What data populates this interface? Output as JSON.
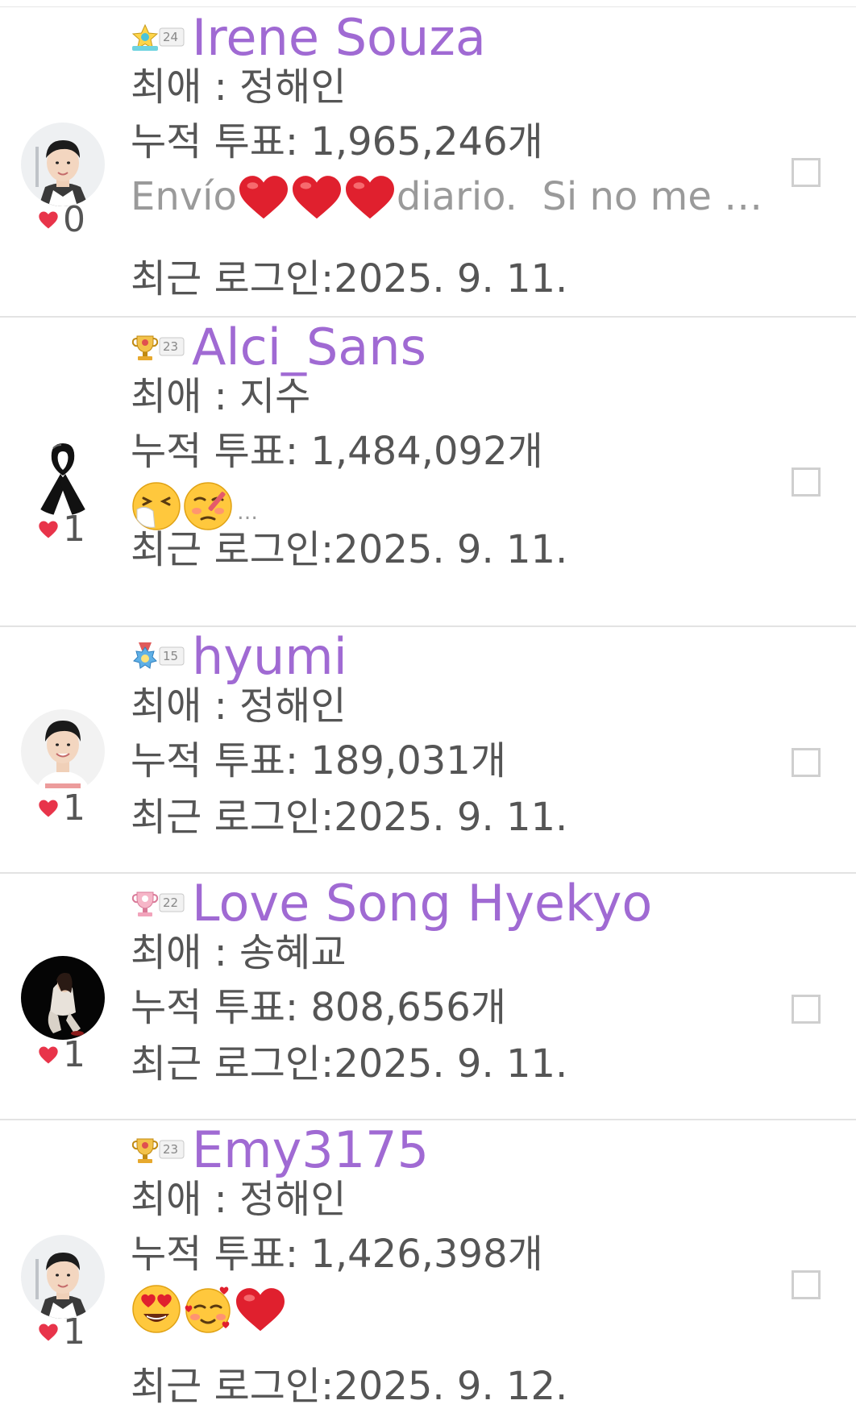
{
  "labels": {
    "favorite_prefix": "최애 : ",
    "votes_prefix": "누적 투표: ",
    "votes_suffix": "개",
    "login_prefix": "최근 로그인:"
  },
  "colors": {
    "username": "#a06ad3",
    "text": "#555555",
    "muted": "#9a9a9a",
    "heart": "#e8344a",
    "divider": "#e3e3e3"
  },
  "users": [
    {
      "badge_icon": "star-badge-icon",
      "badge_level": "24",
      "username": "Irene Souza",
      "favorite": "정해인",
      "votes": "1,965,246",
      "status_parts": [
        "Envío",
        "❤️",
        "❤️",
        "❤️",
        "diario.  Si no me …"
      ],
      "last_login": "2025. 9. 11.",
      "likes": "0",
      "avatar": "man-photo-avatar"
    },
    {
      "badge_icon": "trophy-badge-icon",
      "badge_level": "23",
      "username": "Alci_Sans",
      "favorite": "지수",
      "votes": "1,484,092",
      "status_parts": [
        "🤧",
        "🤒",
        "…"
      ],
      "last_login": "2025. 9. 11.",
      "likes": "1",
      "avatar": "black-ribbon-avatar"
    },
    {
      "badge_icon": "medal-badge-icon",
      "badge_level": "15",
      "username": "hyumi",
      "favorite": "정해인",
      "votes": "189,031",
      "status_parts": [],
      "last_login": "2025. 9. 11.",
      "likes": "1",
      "avatar": "smiling-man-avatar"
    },
    {
      "badge_icon": "pink-trophy-badge-icon",
      "badge_level": "22",
      "username": "Love Song Hyekyo",
      "favorite": "송혜교",
      "votes": "808,656",
      "status_parts": [],
      "last_login": "2025. 9. 11.",
      "likes": "1",
      "avatar": "woman-dark-avatar"
    },
    {
      "badge_icon": "trophy-badge-icon",
      "badge_level": "23",
      "username": "Emy3175",
      "favorite": "정해인",
      "votes": "1,426,398",
      "status_parts": [
        "😍",
        "🥰",
        "❤️"
      ],
      "last_login": "2025. 9. 12.",
      "likes": "1",
      "avatar": "man-photo-avatar"
    }
  ]
}
